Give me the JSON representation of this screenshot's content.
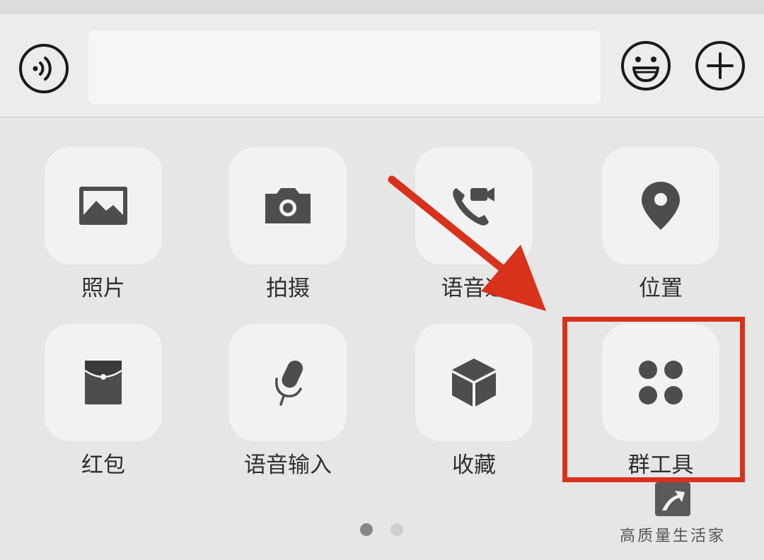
{
  "input_bar": {
    "voice_icon": "voice-wave-icon",
    "emoji_icon": "smiley-face-icon",
    "plus_icon": "plus-circle-icon",
    "text_value": ""
  },
  "panel": {
    "items": [
      {
        "label": "照片",
        "icon": "photo-icon"
      },
      {
        "label": "拍摄",
        "icon": "camera-icon"
      },
      {
        "label": "语音通",
        "icon": "video-call-icon"
      },
      {
        "label": "位置",
        "icon": "location-pin-icon"
      },
      {
        "label": "红包",
        "icon": "red-envelope-icon"
      },
      {
        "label": "语音输入",
        "icon": "microphone-icon"
      },
      {
        "label": "收藏",
        "icon": "favorites-cube-icon"
      },
      {
        "label": "群工具",
        "icon": "group-tools-icon"
      }
    ],
    "pagination": {
      "current_page": 1,
      "total_pages": 2
    }
  },
  "annotation": {
    "highlight_color": "#d8321c",
    "arrow_color": "#d8321c"
  },
  "watermark": {
    "text": "高质量生活家"
  },
  "colors": {
    "icon_gray": "#4d4d4d",
    "tile_bg": "#f2f2f2",
    "dot_active": "#888888",
    "dot_inactive": "#cfcfcf"
  }
}
